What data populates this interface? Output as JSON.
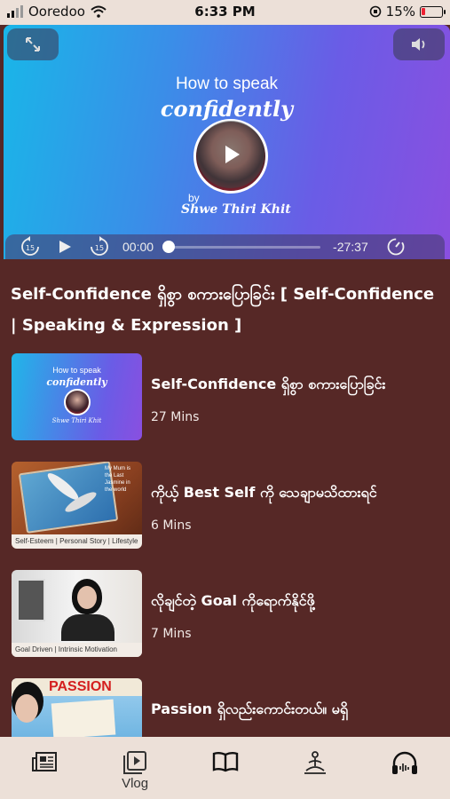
{
  "status_bar": {
    "carrier": "Ooredoo",
    "time": "6:33 PM",
    "battery": "15%"
  },
  "video": {
    "title_line1": "How to speak",
    "title_line2": "confidently",
    "by": "by",
    "author": "Shwe Thiri Khit",
    "current_time": "00:00",
    "remaining_time": "-27:37",
    "progress": 0
  },
  "page_title": "Self-Confidence ရှိစွာ စကားပြောခြင်း [ Self-Confidence | Speaking & Expression ]",
  "episodes": [
    {
      "title": "Self-Confidence ရှိစွာ စကားပြောခြင်း",
      "duration": "27 Mins",
      "thumb_text1": "How to speak",
      "thumb_text2": "confidently",
      "thumb_text3": "Shwe Thiri Khit"
    },
    {
      "title": "ကိုယ့် Best Self ကို သေချာမသိထားရင်",
      "duration": "6 Mins",
      "thumb_caption": "Self-Esteem | Personal Story | Lifestyle",
      "thumb_text": "My Mum is the Last Jasmine in the world"
    },
    {
      "title": "လိုချင်တဲ့ Goal ကိုရောက်နိုင်ဖို့",
      "duration": "7 Mins",
      "thumb_caption": "Goal Driven | Intrinsic Motivation"
    },
    {
      "title": "Passion ရှိလည်းကောင်းတယ်။ မရှိ",
      "duration": "",
      "thumb_text": "PASSION"
    }
  ],
  "tabs": [
    {
      "label": "",
      "icon": "news-icon"
    },
    {
      "label": "Vlog",
      "icon": "video-icon"
    },
    {
      "label": "",
      "icon": "book-icon"
    },
    {
      "label": "",
      "icon": "meditation-icon"
    },
    {
      "label": "",
      "icon": "headphones-icon"
    }
  ]
}
